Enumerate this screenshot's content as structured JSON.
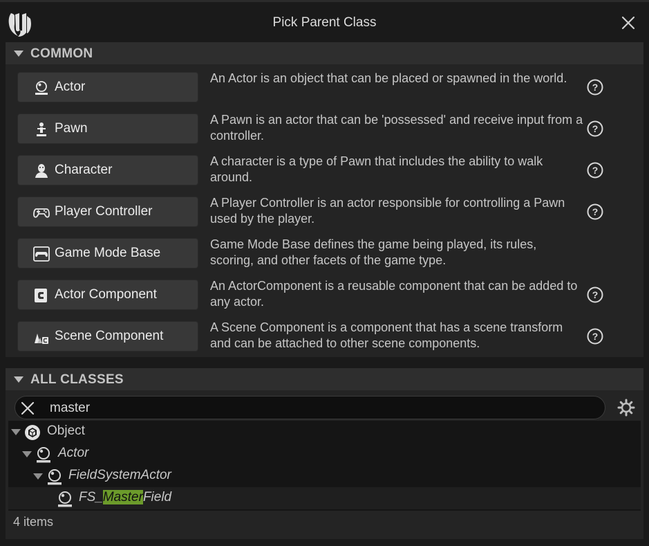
{
  "window": {
    "title": "Pick Parent Class"
  },
  "common": {
    "header": "COMMON",
    "classes": [
      {
        "label": "Actor",
        "description": "An Actor is an object that can be placed or spawned in the world.",
        "icon": "actor-icon",
        "help": true
      },
      {
        "label": "Pawn",
        "description": "A Pawn is an actor that can be 'possessed' and receive input from a controller.",
        "icon": "pawn-icon",
        "help": true
      },
      {
        "label": "Character",
        "description": "A character is a type of Pawn that includes the ability to walk around.",
        "icon": "character-icon",
        "help": true
      },
      {
        "label": "Player Controller",
        "description": "A Player Controller is an actor responsible for controlling a Pawn used by the player.",
        "icon": "gamepad-icon",
        "help": true
      },
      {
        "label": "Game Mode Base",
        "description": "Game Mode Base defines the game being played, its rules, scoring, and other facets of the game type.",
        "icon": "game-mode-icon",
        "help": false
      },
      {
        "label": "Actor Component",
        "description": "An ActorComponent is a reusable component that can be added to any actor.",
        "icon": "actor-component-icon",
        "help": true
      },
      {
        "label": "Scene Component",
        "description": "A Scene Component is a component that has a scene transform and can be attached to other scene components.",
        "icon": "scene-component-icon",
        "help": true
      }
    ]
  },
  "all_classes": {
    "header": "ALL CLASSES",
    "search": {
      "value": "master"
    },
    "tree": [
      {
        "label": "Object",
        "italic": false
      },
      {
        "label": "Actor",
        "italic": true
      },
      {
        "label": "FieldSystemActor",
        "italic": true
      },
      {
        "label_prefix": "FS_",
        "label_match": "Master",
        "label_suffix": "Field",
        "italic": true
      }
    ],
    "status": "4 items"
  },
  "colors": {
    "highlight": "#6c9b2b",
    "background": "#1a1a1a",
    "button": "#383838"
  }
}
